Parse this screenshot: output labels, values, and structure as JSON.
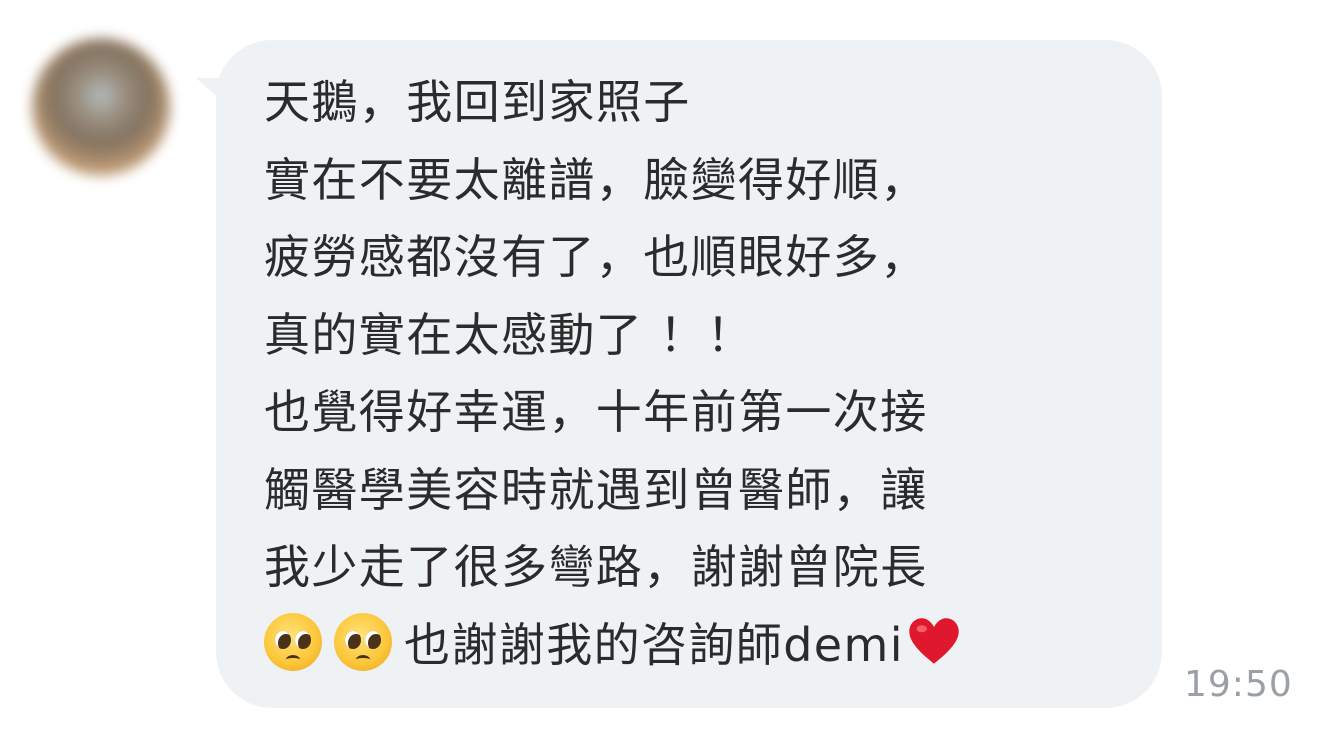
{
  "message": {
    "lines": [
      "天鵝，我回到家照子",
      "實在不要太離譜，臉變得好順，",
      "疲勞感都沒有了，也順眼好多，",
      "真的實在太感動了 ！！",
      "也覺得好幸運，十年前第一次接",
      "觸醫學美容時就遇到曾醫師，讓",
      "我少走了很多彎路，謝謝曾院長"
    ],
    "last_line_text": "也謝謝我的咨詢師demi",
    "emojis": [
      "pleading-face",
      "pleading-face"
    ],
    "end_emoji": "red-heart",
    "timestamp": "19:50"
  },
  "colors": {
    "bubble": "#eff2f5",
    "text": "#2b2b2b",
    "timestamp": "#9aa0a6",
    "heart": "#e0182d"
  }
}
